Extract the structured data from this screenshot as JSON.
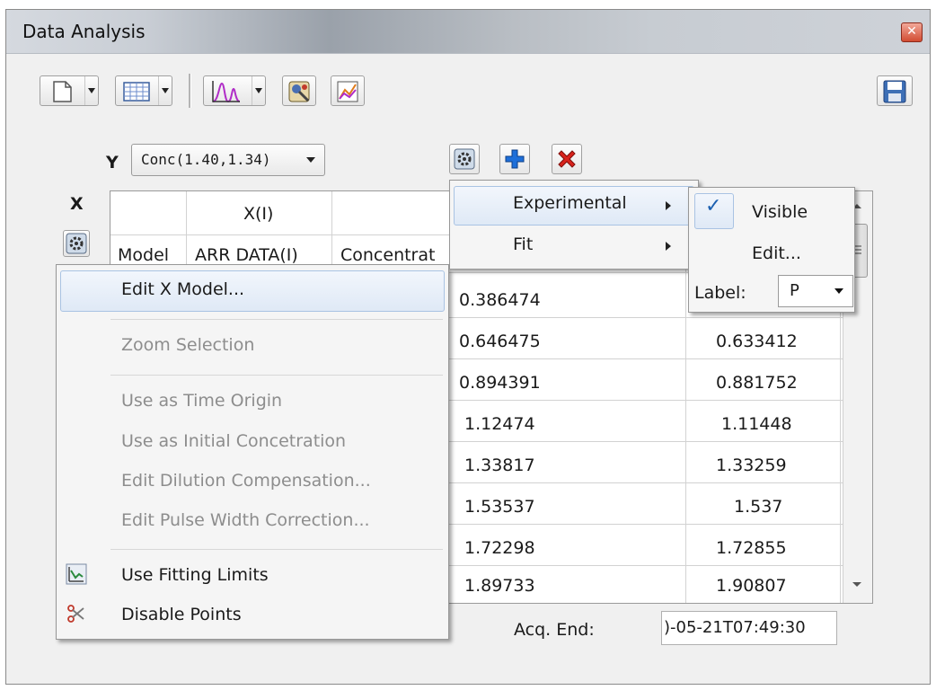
{
  "window": {
    "title": "Data Analysis"
  },
  "y_selector": {
    "label": "Y",
    "value": "Conc(1.40,1.34)"
  },
  "x_label": "X",
  "table": {
    "group_header": "X(I)",
    "columns": [
      "Model",
      "ARR DATA(I)",
      "Concentrat"
    ],
    "col3_values": [
      "0.386474",
      "0.646475",
      "0.894391",
      "1.12474",
      "1.33817",
      "1.53537",
      "1.72298",
      "1.89733"
    ],
    "col4_values": [
      "0.633412",
      "0.881752",
      "1.11448",
      "1.33259",
      "1.537",
      "1.72855",
      "1.90807"
    ]
  },
  "acq_end": {
    "label": "Acq. End:",
    "value": ")-05-21T07:49:30"
  },
  "context_menu": {
    "items": [
      {
        "label": "Edit X Model...",
        "enabled": true
      },
      {
        "label": "Zoom Selection",
        "enabled": false
      },
      {
        "label": "Use as Time Origin",
        "enabled": false
      },
      {
        "label": "Use as Initial Concetration",
        "enabled": false
      },
      {
        "label": "Edit Dilution Compensation...",
        "enabled": false
      },
      {
        "label": "Edit Pulse Width Correction...",
        "enabled": false
      },
      {
        "label": "Use Fitting Limits",
        "enabled": true
      },
      {
        "label": "Disable Points",
        "enabled": true
      }
    ]
  },
  "gear_menu": {
    "items": [
      {
        "label": "Experimental",
        "has_submenu": true
      },
      {
        "label": "Fit",
        "has_submenu": true
      }
    ]
  },
  "experimental_submenu": {
    "visible_label": "Visible",
    "visible_checked": true,
    "edit_label": "Edit...",
    "label_field": {
      "label": "Label:",
      "value": "P"
    }
  },
  "colors": {
    "highlight": "#dfe9f6",
    "add": "#1e6fd9",
    "delete": "#d8221c",
    "check": "#1b5fb0"
  }
}
